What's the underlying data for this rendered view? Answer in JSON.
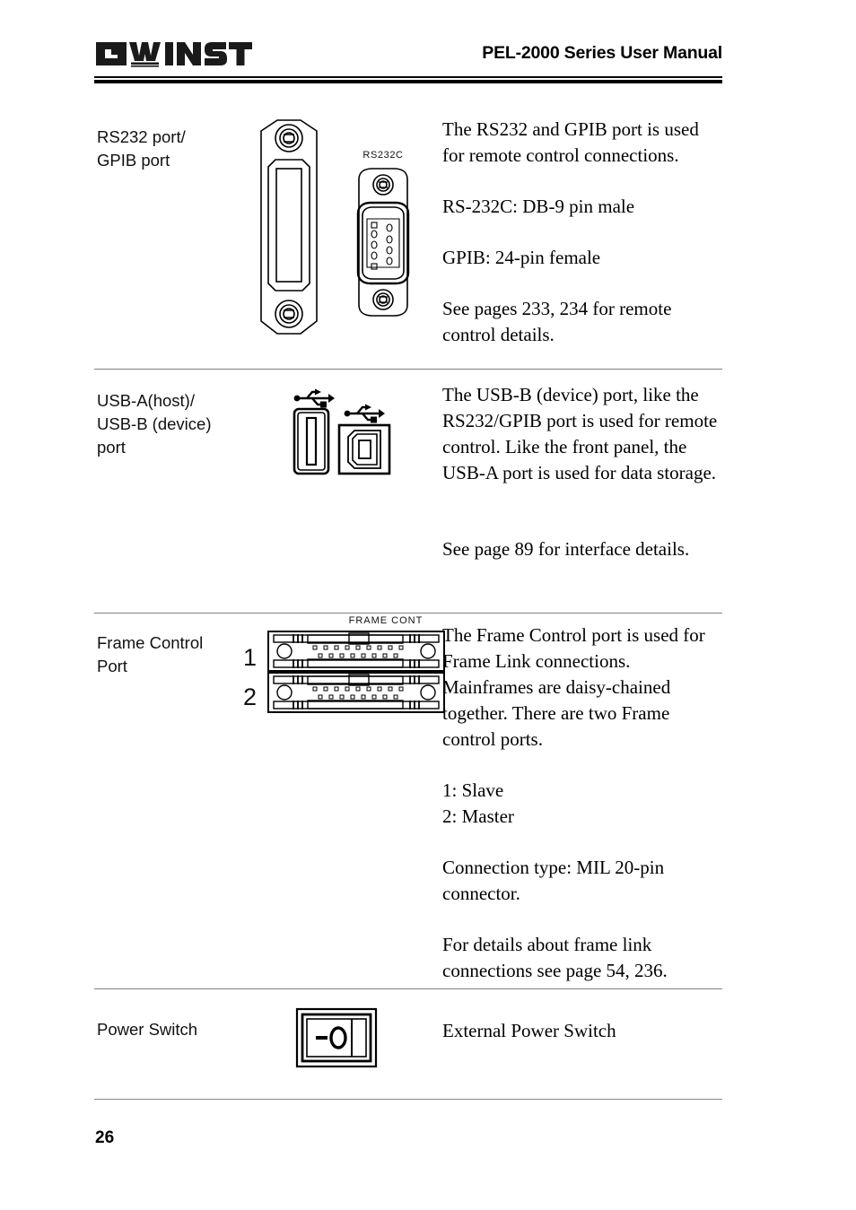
{
  "header": {
    "logo_text": "GW INSTEK",
    "title": "PEL-2000 Series User Manual"
  },
  "footer": {
    "page_number": "26"
  },
  "rows": [
    {
      "label": "RS232 port/\nGPIB port",
      "label_line1": "RS232 port/",
      "label_line2": "GPIB port",
      "figure": {
        "name": "rs232-gpib-connector-drawing",
        "caption": "RS232C"
      },
      "description": [
        "The RS232 and GPIB port is used for remote control connections.",
        "RS-232C: DB-9 pin male",
        "GPIB: 24-pin female",
        "See pages 233, 234 for remote control details."
      ]
    },
    {
      "label_line1": "USB-A(host)/",
      "label_line2": "USB-B (device)",
      "label_line3": "port",
      "figure": {
        "name": "usb-a-usb-b-connector-drawing",
        "caption": ""
      },
      "description": [
        "The USB-B (device) port, like the RS232/GPIB port is used for remote control. Like the front panel, the USB-A port is used for data storage.",
        "See page 89 for interface details."
      ]
    },
    {
      "label_line1": "Frame Control",
      "label_line2": "Port",
      "figure": {
        "name": "frame-control-connector-drawing",
        "caption": "FRAME  CONT",
        "port_1_number": "1",
        "port_2_number": "2"
      },
      "description": [
        "The Frame Control port is used for Frame Link connections. Mainframes are daisy-chained together. There are two Frame control ports.",
        "1: Slave",
        "2: Master",
        "Connection type: MIL 20-pin connector.",
        "For details about frame link connections see page 54, 236."
      ]
    },
    {
      "label_line1": "Power Switch",
      "figure": {
        "name": "power-rocker-switch-drawing",
        "caption": "",
        "marking": "−O"
      },
      "description": [
        "External Power Switch"
      ]
    }
  ]
}
